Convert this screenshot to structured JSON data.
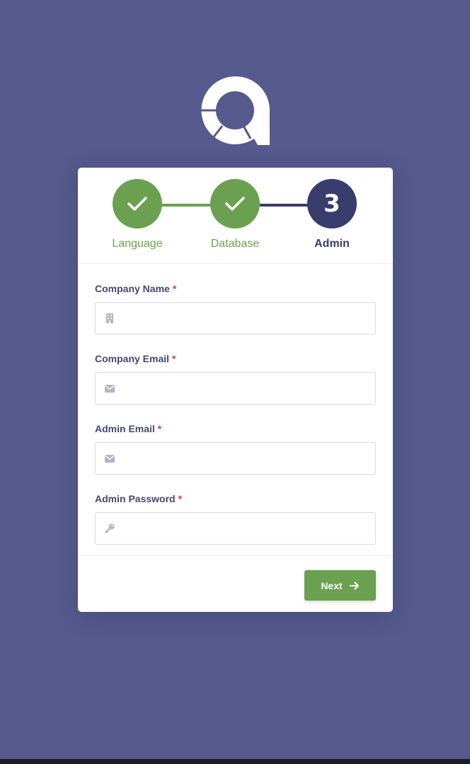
{
  "steps": [
    {
      "label": "Language",
      "status": "done"
    },
    {
      "label": "Database",
      "status": "done"
    },
    {
      "number": "3",
      "label": "Admin",
      "status": "active"
    }
  ],
  "fields": [
    {
      "label": "Company Name",
      "required_mark": "*",
      "icon": "building-icon",
      "value": "",
      "placeholder": ""
    },
    {
      "label": "Company Email",
      "required_mark": "*",
      "icon": "envelope-icon",
      "value": "",
      "placeholder": ""
    },
    {
      "label": "Admin Email",
      "required_mark": "*",
      "icon": "envelope-icon",
      "value": "",
      "placeholder": ""
    },
    {
      "label": "Admin Password",
      "required_mark": "*",
      "icon": "key-icon",
      "value": "",
      "placeholder": ""
    }
  ],
  "next_button": {
    "label": "Next",
    "icon": "arrow-right-icon"
  },
  "colors": {
    "background": "#565a8c",
    "success": "#6aa04f",
    "primary": "#393d6d",
    "required": "#e0324b"
  }
}
